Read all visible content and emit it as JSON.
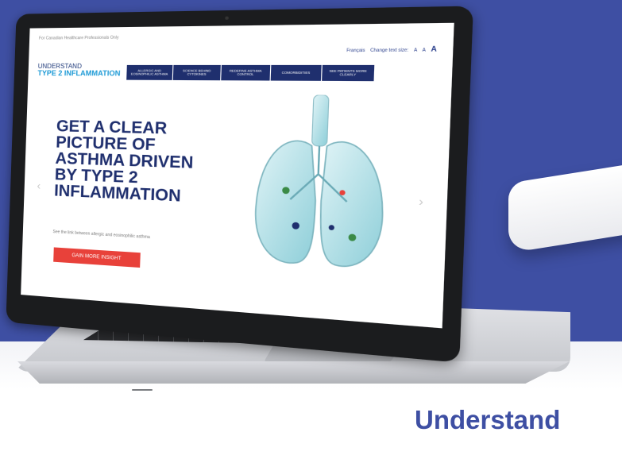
{
  "screen": {
    "disclaimer": "For Canadian Healthcare Professionals Only",
    "language_link": "Français",
    "text_size_label": "Change text size:",
    "text_size_small": "A",
    "text_size_medium": "A",
    "text_size_large": "A",
    "brand_line1": "UNDERSTAND",
    "brand_line2": "TYPE 2 INFLAMMATION",
    "nav": [
      {
        "label": "ALLERGIC AND EOSINOPHILIC ASTHMA"
      },
      {
        "label": "SCIENCE BEHIND CYTOKINES"
      },
      {
        "label": "REDEFINE ASTHMA CONTROL"
      },
      {
        "label": "COMORBIDITIES"
      },
      {
        "label": "SEE PATIENTS MORE CLEARLY"
      }
    ],
    "hero_title": "GET A CLEAR\nPICTURE OF\nASTHMA DRIVEN\nBY TYPE 2\nINFLAMMATION",
    "hero_subtitle": "See the link between allergic and eosinophilic asthma",
    "cta_label": "GAIN MORE INSIGHT",
    "arrow_prev": "‹",
    "arrow_next": "›"
  },
  "caption": "Understand",
  "colors": {
    "background_blue": "#3e4fa3",
    "navy": "#1f2f6e",
    "accent_blue": "#1d9ad6",
    "cta_red": "#e8413a"
  },
  "icons": [
    "lungs-illustration-icon",
    "prev-arrow-icon",
    "next-arrow-icon"
  ]
}
